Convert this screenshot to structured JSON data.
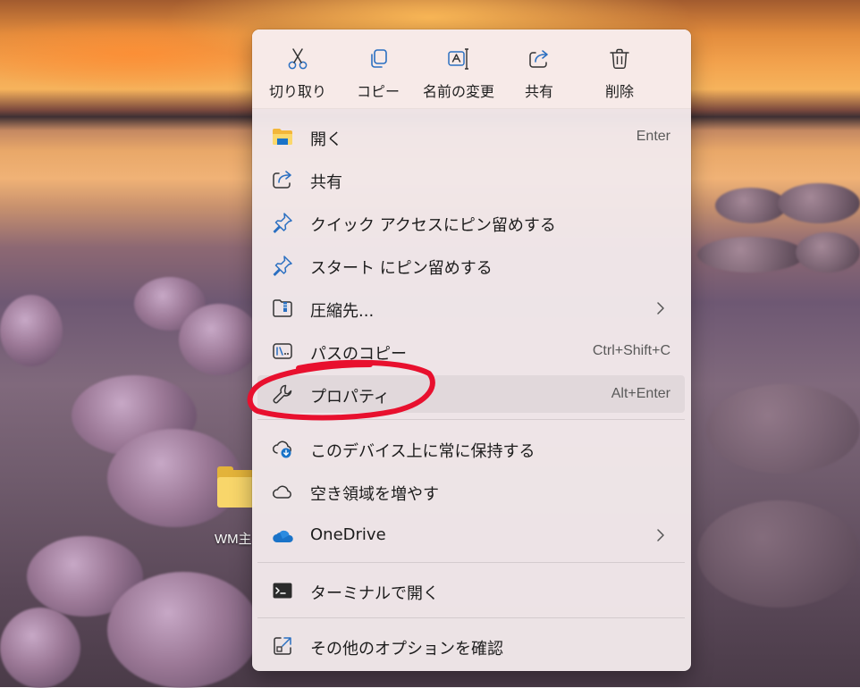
{
  "desktop": {
    "folder_label": "WM主"
  },
  "toolbar": {
    "buttons": [
      {
        "label": "切り取り",
        "icon": "scissors-icon"
      },
      {
        "label": "コピー",
        "icon": "copy-icon"
      },
      {
        "label": "名前の変更",
        "icon": "rename-icon"
      },
      {
        "label": "共有",
        "icon": "share-icon"
      },
      {
        "label": "削除",
        "icon": "trash-icon"
      }
    ]
  },
  "menu": {
    "items": [
      {
        "label": "開く",
        "shortcut": "Enter",
        "icon": "folder-icon"
      },
      {
        "label": "共有",
        "shortcut": "",
        "icon": "share-icon"
      },
      {
        "label": "クイック アクセスにピン留めする",
        "shortcut": "",
        "icon": "pin-icon"
      },
      {
        "label": "スタート にピン留めする",
        "shortcut": "",
        "icon": "pin-icon"
      },
      {
        "label": "圧縮先...",
        "shortcut": "",
        "icon": "zip-folder-icon",
        "submenu": true
      },
      {
        "label": "パスのコピー",
        "shortcut": "Ctrl+Shift+C",
        "icon": "copy-path-icon"
      },
      {
        "label": "プロパティ",
        "shortcut": "Alt+Enter",
        "icon": "wrench-icon",
        "highlighted": true
      },
      {
        "label": "このデバイス上に常に保持する",
        "shortcut": "",
        "icon": "cloud-download-icon"
      },
      {
        "label": "空き領域を増やす",
        "shortcut": "",
        "icon": "cloud-outline-icon"
      },
      {
        "label": "OneDrive",
        "shortcut": "",
        "icon": "onedrive-icon",
        "submenu": true
      },
      {
        "label": "ターミナルで開く",
        "shortcut": "",
        "icon": "terminal-icon"
      },
      {
        "label": "その他のオプションを確認",
        "shortcut": "",
        "icon": "open-external-icon"
      }
    ]
  },
  "colors": {
    "accent": "#1a73c8",
    "annotation": "#e8102e",
    "menu_bg": "#f2e8ea"
  }
}
